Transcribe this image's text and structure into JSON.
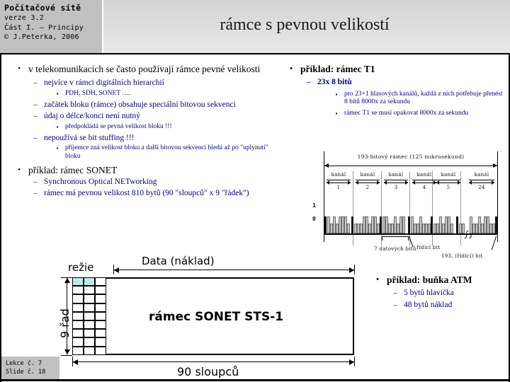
{
  "header": {
    "course_title": "Počítačové sítě",
    "version": "verze 3.2",
    "part": "Část I. – Principy",
    "copyright": "© J.Peterka, 2006"
  },
  "slide_title": "rámce s pevnou velikostí",
  "left_column": {
    "bullets": [
      {
        "level": 1,
        "marker": "•",
        "text": "v telekomunikacích se často používají rámce pevné velikosti"
      },
      {
        "level": 2,
        "marker": "–",
        "text": "nejvíce v rámci digitálních hierarchií"
      },
      {
        "level": 3,
        "marker": "▪",
        "text": "PDH, SDH, SONET …."
      },
      {
        "level": 2,
        "marker": "–",
        "text": "začátek bloku (rámce) obsahuje speciální bitovou sekvenci"
      },
      {
        "level": 2,
        "marker": "–",
        "text": "údaj o délce/konci není nutný"
      },
      {
        "level": 3,
        "marker": "▪",
        "text": "předpokládá se pevná velikost bloku !!!"
      },
      {
        "level": 2,
        "marker": "–",
        "text": "nepoužívá se bit stuffing !!!"
      },
      {
        "level": 3,
        "marker": "▪",
        "text": "příjemce zná velikost bloku a další bitovou sekvenci hledá až po \"uplynutí\" bloku"
      },
      {
        "level": 1,
        "marker": "•",
        "text": "příklad: rámec SONET"
      },
      {
        "level": 2,
        "marker": "–",
        "text": "Synchronous Optical NETworking"
      },
      {
        "level": 2,
        "marker": "–",
        "text": "rámec má pevnou velikost 810 bytů (90 \"sloupců\" x 9 \"řádek\")"
      }
    ]
  },
  "right_column": {
    "bullets": [
      {
        "level": 1,
        "marker": "•",
        "text": "příklad: rámec T1",
        "bold": true
      },
      {
        "level": 2,
        "marker": "–",
        "text": "23x 8 bitů"
      },
      {
        "level": 3,
        "marker": "▪",
        "text": "pro 23+1 hlasových kanálů, každá z nich potřebuje přenést 8 bitů 8000x za sekundu"
      },
      {
        "level": 3,
        "marker": "▪",
        "text": "rámec T1 se musí opakovat 8000x za sekundu"
      }
    ]
  },
  "atm_column": {
    "bullets": [
      {
        "level": 1,
        "marker": "•",
        "text": "příklad: buňka ATM",
        "bold": true
      },
      {
        "level": 2,
        "marker": "–",
        "text": "5 bytů hlavička"
      },
      {
        "level": 2,
        "marker": "–",
        "text": "48 bytů náklad"
      }
    ]
  },
  "t1_figure": {
    "frame_label": "193-bitový rámec   (125 mikrosekund)",
    "channel_word": "kanál",
    "channels": [
      "1",
      "2",
      "3",
      "4",
      "5",
      "24"
    ],
    "axis_high": "1",
    "axis_low": "0",
    "annotation_data_bits": "7  datových bitů",
    "annotation_control_bit": "řídící  bit",
    "annotation_bit_193": "193.  (řídící)  bit"
  },
  "sonet_figure": {
    "overhead_label": "režie",
    "payload_label": "Data (náklad)",
    "rows_label": "9 řad",
    "columns_label": "90 sloupců",
    "frame_label": "rámec SONET STS-1",
    "grid_rows": 9,
    "grid_cols": 3,
    "highlight_cells": 2,
    "highlight_color": "#b9eeea"
  },
  "footer": {
    "lecture": "Lekce č. 7",
    "slide": "Slide č. 18"
  }
}
